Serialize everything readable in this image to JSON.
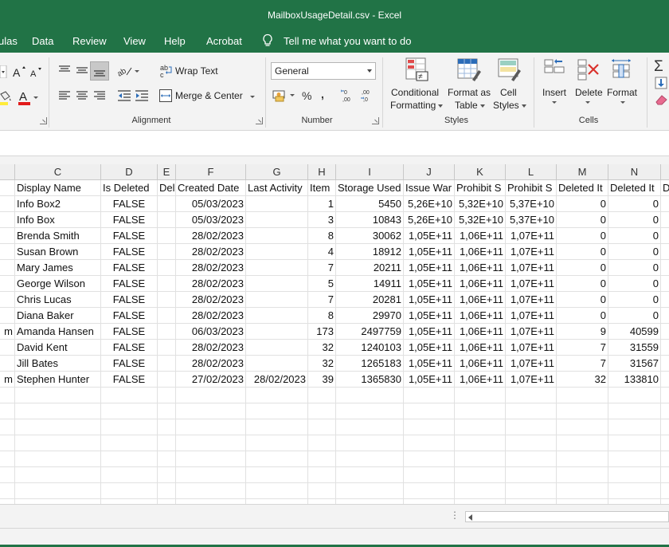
{
  "app": {
    "title": "MailboxUsageDetail.csv  -  Excel"
  },
  "menu": {
    "tabs": [
      "ulas",
      "Data",
      "Review",
      "View",
      "Help",
      "Acrobat"
    ],
    "tell_me": "Tell me what you want to do"
  },
  "ribbon": {
    "alignment": {
      "wrap_text": "Wrap Text",
      "merge_center": "Merge & Center",
      "label": "Alignment"
    },
    "number": {
      "format_value": "General",
      "label": "Number"
    },
    "styles": {
      "conditional_1": "Conditional",
      "conditional_2": "Formatting",
      "format_as_1": "Format as",
      "format_as_2": "Table",
      "cell_styles_1": "Cell",
      "cell_styles_2": "Styles",
      "label": "Styles"
    },
    "cells": {
      "insert": "Insert",
      "delete": "Delete",
      "format": "Format",
      "label": "Cells"
    }
  },
  "sheet": {
    "column_letters": [
      "",
      "C",
      "D",
      "E",
      "F",
      "G",
      "H",
      "I",
      "J",
      "K",
      "L",
      "M",
      "N",
      ""
    ],
    "header_row": [
      "",
      "Display Name",
      "Is Deleted",
      "Del",
      "Created Date",
      "Last Activity",
      "Item",
      "Storage Used",
      "Issue War",
      "Prohibit S",
      "Prohibit S",
      "Deleted It",
      "Deleted It",
      "D"
    ],
    "rows": [
      [
        "",
        "Info Box2",
        "FALSE",
        "",
        "05/03/2023",
        "",
        "1",
        "5450",
        "5,26E+10",
        "5,32E+10",
        "5,37E+10",
        "0",
        "0",
        ""
      ],
      [
        "",
        "Info Box",
        "FALSE",
        "",
        "05/03/2023",
        "",
        "3",
        "10843",
        "5,26E+10",
        "5,32E+10",
        "5,37E+10",
        "0",
        "0",
        ""
      ],
      [
        "",
        "Brenda Smith",
        "FALSE",
        "",
        "28/02/2023",
        "",
        "8",
        "30062",
        "1,05E+11",
        "1,06E+11",
        "1,07E+11",
        "0",
        "0",
        ""
      ],
      [
        "",
        "Susan Brown",
        "FALSE",
        "",
        "28/02/2023",
        "",
        "4",
        "18912",
        "1,05E+11",
        "1,06E+11",
        "1,07E+11",
        "0",
        "0",
        ""
      ],
      [
        "",
        "Mary James",
        "FALSE",
        "",
        "28/02/2023",
        "",
        "7",
        "20211",
        "1,05E+11",
        "1,06E+11",
        "1,07E+11",
        "0",
        "0",
        ""
      ],
      [
        "",
        "George Wilson",
        "FALSE",
        "",
        "28/02/2023",
        "",
        "5",
        "14911",
        "1,05E+11",
        "1,06E+11",
        "1,07E+11",
        "0",
        "0",
        ""
      ],
      [
        "",
        "Chris Lucas",
        "FALSE",
        "",
        "28/02/2023",
        "",
        "7",
        "20281",
        "1,05E+11",
        "1,06E+11",
        "1,07E+11",
        "0",
        "0",
        ""
      ],
      [
        "",
        "Diana Baker",
        "FALSE",
        "",
        "28/02/2023",
        "",
        "8",
        "29970",
        "1,05E+11",
        "1,06E+11",
        "1,07E+11",
        "0",
        "0",
        ""
      ],
      [
        "m",
        "Amanda Hansen",
        "FALSE",
        "",
        "06/03/2023",
        "",
        "173",
        "2497759",
        "1,05E+11",
        "1,06E+11",
        "1,07E+11",
        "9",
        "40599",
        ""
      ],
      [
        "",
        "David Kent",
        "FALSE",
        "",
        "28/02/2023",
        "",
        "32",
        "1240103",
        "1,05E+11",
        "1,06E+11",
        "1,07E+11",
        "7",
        "31559",
        ""
      ],
      [
        "",
        "Jill Bates",
        "FALSE",
        "",
        "28/02/2023",
        "",
        "32",
        "1265183",
        "1,05E+11",
        "1,06E+11",
        "1,07E+11",
        "7",
        "31567",
        ""
      ],
      [
        "m",
        "Stephen Hunter",
        "FALSE",
        "",
        "27/02/2023",
        "28/02/2023",
        "39",
        "1365830",
        "1,05E+11",
        "1,06E+11",
        "1,07E+11",
        "32",
        "133810",
        ""
      ]
    ]
  }
}
